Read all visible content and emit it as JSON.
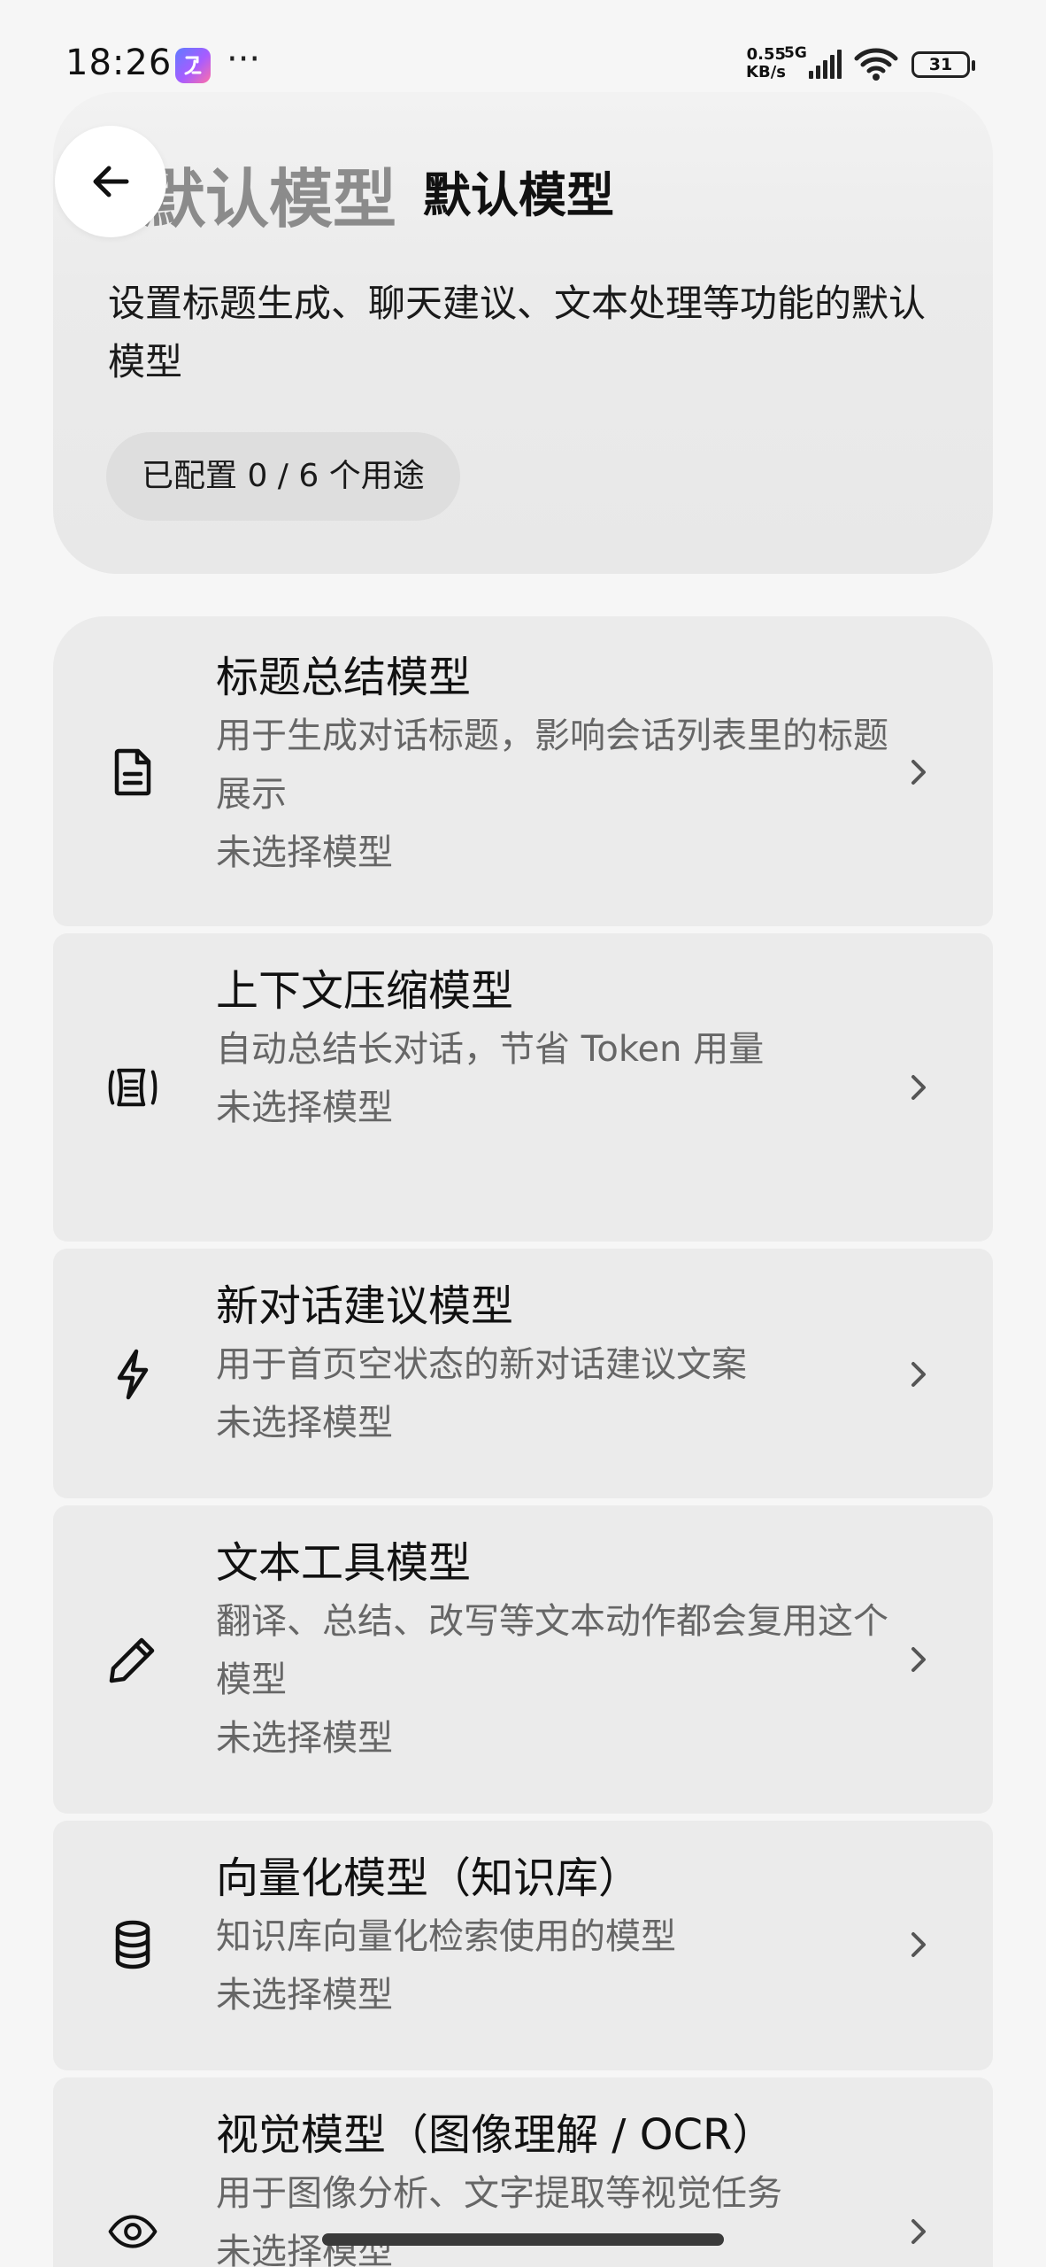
{
  "status_bar": {
    "time": "18:26",
    "more": "···",
    "net_speed_value": "0.55",
    "net_speed_unit": "KB/s",
    "network": "5G",
    "battery": "31"
  },
  "header": {
    "bg_title": "默认模型",
    "title": "默认模型",
    "description": "设置标题生成、聊天建议、文本处理等功能的默认模型",
    "chip": "已配置 0 / 6 个用途"
  },
  "items": [
    {
      "title": "标题总结模型",
      "desc": "用于生成对话标题，影响会话列表里的标题展示",
      "status": "未选择模型",
      "icon": "document-icon"
    },
    {
      "title": "上下文压缩模型",
      "desc": "自动总结长对话，节省 Token 用量",
      "status": "未选择模型",
      "icon": "compress-icon"
    },
    {
      "title": "新对话建议模型",
      "desc": "用于首页空状态的新对话建议文案",
      "status": "未选择模型",
      "icon": "lightning-icon"
    },
    {
      "title": "文本工具模型",
      "desc": "翻译、总结、改写等文本动作都会复用这个模型",
      "status": "未选择模型",
      "icon": "pencil-icon"
    },
    {
      "title": "向量化模型（知识库）",
      "desc": "知识库向量化检索使用的模型",
      "status": "未选择模型",
      "icon": "database-icon"
    },
    {
      "title": "视觉模型（图像理解 / OCR）",
      "desc": "用于图像分析、文字提取等视觉任务",
      "status": "未选择模型",
      "icon": "eye-icon"
    }
  ]
}
